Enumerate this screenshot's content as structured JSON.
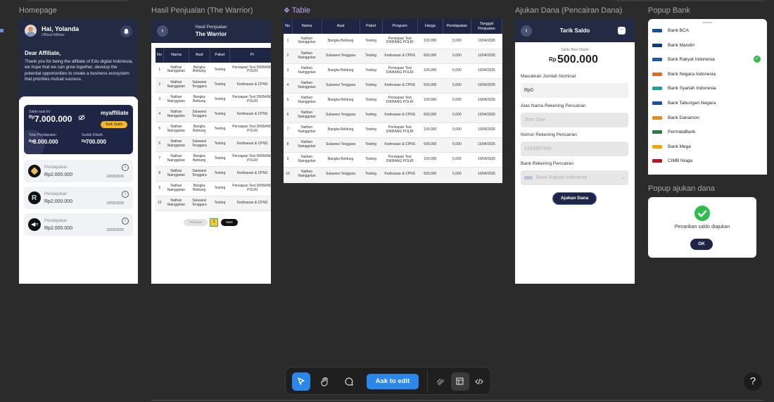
{
  "canvas": {
    "labels": {
      "homepage": "Homepage",
      "hasil": "Hasil Penjualan (The Warrior)",
      "table": "Table",
      "ajukan": "Ajukan Dana (Pencairan Dana)",
      "popup_bank": "Popup Bank",
      "popup_ajukan": "Popup ajukan dana"
    }
  },
  "homepage": {
    "greeting": "Hai, Yolanda",
    "role": "Official Affiliate",
    "dear": "Dear Affiliate,",
    "message": "Thank you for being the affiliate of Edu digital Indonesia, we hope that we can grow together, develop the potential opportunities to create a business ecosystem that priorities mutual success.",
    "card": {
      "saldo_label": "Saldo saat ini",
      "currency": "Rp",
      "saldo": "7.000.000",
      "brand": "myaffiliate",
      "tarik_button": "Tarik Saldo",
      "total_label": "Total Pendapatan",
      "total": "8.000.000",
      "ditarik_label": "Sudah Ditarik",
      "ditarik": "700.000"
    },
    "items": [
      {
        "label": "Pendapatan",
        "amount": "Rp2.000.000",
        "date": "10/05/2026"
      },
      {
        "label": "Pendapatan",
        "amount": "Rp2.000.000",
        "date": "10/05/2026"
      },
      {
        "label": "Pendapatan",
        "amount": "Rp2.000.000",
        "date": "10/05/2026"
      }
    ]
  },
  "hasil": {
    "title": "Hasil Penjualan",
    "subtitle": "The Warrior",
    "columns": [
      "No",
      "Nama",
      "Asal",
      "Paket",
      "Pr"
    ],
    "rows": [
      [
        "1",
        "Nathan Nainggolan",
        "Bangka Belitung",
        "Testing",
        "Persiapan Test DIKBANG POLRI"
      ],
      [
        "2",
        "Nathan Nainggolan",
        "Sulawesi Tenggara",
        "Testing",
        "Kedinasan & CPNS"
      ],
      [
        "3",
        "Nathan Nainggolan",
        "Bangka Belitung",
        "Testing",
        "Persiapan Test DIKBANG POLRI"
      ],
      [
        "4",
        "Nathan Nainggolan",
        "Sulawesi Tenggara",
        "Testing",
        "Kedinasan & CPNS"
      ],
      [
        "5",
        "Nathan Nainggolan",
        "Bangka Belitung",
        "Testing",
        "Persiapan Test DIKBANG POLRI"
      ],
      [
        "6",
        "Nathan Nainggolan",
        "Sulawesi Tenggara",
        "Testing",
        "Kedinasan & CPNS"
      ],
      [
        "7",
        "Nathan Nainggolan",
        "Bangka Belitung",
        "Testing",
        "Persiapan Test DIKBANG POLRI"
      ],
      [
        "8",
        "Nathan Nainggolan",
        "Sulawesi Tenggara",
        "Testing",
        "Kedinasan & CPNS"
      ],
      [
        "9",
        "Nathan Nainggolan",
        "Bangka Belitung",
        "Testing",
        "Persiapan Test DIKBANG POLRI"
      ],
      [
        "10",
        "Nathan Nainggolan",
        "Sulawesi Tenggara",
        "Testing",
        "Kedinasan & CPNS"
      ]
    ],
    "pagination": {
      "prev": "Previous",
      "page": "1",
      "next": "Next"
    }
  },
  "table": {
    "columns": [
      "No",
      "Nama",
      "Asal",
      "Paket",
      "Program",
      "Harga",
      "Pendapatan",
      "Tanggal Penjualan"
    ],
    "rows": [
      [
        "1",
        "Nathan Nainggolan",
        "Bangka Belitung",
        "Testing",
        "Persiapan Test DIKBANG POLRI",
        "100,000",
        "5,000",
        "10/04/2026"
      ],
      [
        "2",
        "Nathan Nainggolan",
        "Sulawesi Tenggara",
        "Testing",
        "Kedinasan & CPNS",
        "600,000",
        "5,000",
        "10/04/2026"
      ],
      [
        "3",
        "Nathan Nainggolan",
        "Bangka Belitung",
        "Testing",
        "Persiapan Test DIKBANG POLRI",
        "100,000",
        "5,000",
        "10/04/2026"
      ],
      [
        "4",
        "Nathan Nainggolan",
        "Sulawesi Tenggara",
        "Testing",
        "Kedinasan & CPNS",
        "600,000",
        "5,000",
        "10/04/2026"
      ],
      [
        "5",
        "Nathan Nainggolan",
        "Bangka Belitung",
        "Testing",
        "Persiapan Test DIKBANG POLRI",
        "100,000",
        "5,000",
        "10/04/2026"
      ],
      [
        "6",
        "Nathan Nainggolan",
        "Sulawesi Tenggara",
        "Testing",
        "Kedinasan & CPNS",
        "600,000",
        "5,000",
        "10/04/2026"
      ],
      [
        "7",
        "Nathan Nainggolan",
        "Bangka Belitung",
        "Testing",
        "Persiapan Test DIKBANG POLRI",
        "100,000",
        "5,000",
        "10/04/2026"
      ],
      [
        "8",
        "Nathan Nainggolan",
        "Sulawesi Tenggara",
        "Testing",
        "Kedinasan & CPNS",
        "600,000",
        "5,000",
        "10/04/2026"
      ],
      [
        "9",
        "Nathan Nainggolan",
        "Bangka Belitung",
        "Testing",
        "Persiapan Test DIKBANG POLRI",
        "100,000",
        "5,000",
        "10/04/2026"
      ],
      [
        "10",
        "Nathan Nainggolan",
        "Sulawesi Tenggara",
        "Testing",
        "Kedinasan & CPNS",
        "600,000",
        "5,000",
        "10/04/2026"
      ]
    ]
  },
  "ajukan": {
    "title": "Tarik Saldo",
    "saldo_label": "Saldo Bisa Ditarik",
    "currency": "Rp",
    "saldo": "500.000",
    "fields": {
      "nominal_label": "Masukkan Jumlah Nominal",
      "nominal_value": "Rp0",
      "nama_label": "Atas Nama Rekening Pencairan",
      "nama_placeholder": "Jhon Doe",
      "nomor_label": "Nomor Rekening Pencairan",
      "nomor_placeholder": "1234567890",
      "bank_label": "Bank Rekening Pencairan",
      "bank_value": "Bank Rakyat Indonesia"
    },
    "submit": "Ajukan Dana"
  },
  "popup_bank": {
    "banks": [
      {
        "name": "Bank BCA",
        "color": "#1a4da1"
      },
      {
        "name": "Bank Mandiri",
        "color": "#0b3a7a"
      },
      {
        "name": "Bank Rakyat Indonesia",
        "color": "#1b5bab",
        "selected": true
      },
      {
        "name": "Bank Negara Indonesia",
        "color": "#e46a1c"
      },
      {
        "name": "Bank Syariah Indonesia",
        "color": "#19a39a"
      },
      {
        "name": "Bank Tabungan Negara",
        "color": "#1e4fa0",
        "logo": "btn"
      },
      {
        "name": "Bank Danamon",
        "color": "#e98a1f"
      },
      {
        "name": "PermataBank",
        "color": "#2c7d3d"
      },
      {
        "name": "Bank Mega",
        "color": "#f2a900"
      },
      {
        "name": "CIMB Niaga",
        "color": "#b3191f"
      }
    ]
  },
  "popup_ajukan": {
    "message": "Penarikan saldo diajukan",
    "ok": "OK"
  },
  "toolbar": {
    "ask_to_edit": "Ask to edit",
    "help": "?"
  }
}
